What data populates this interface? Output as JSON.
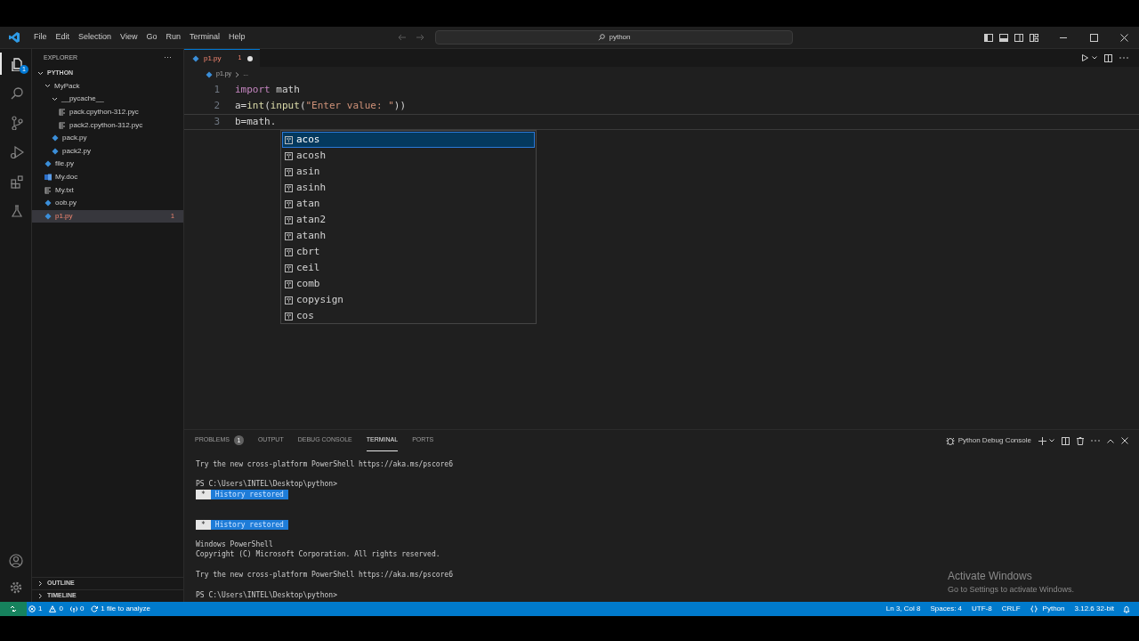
{
  "menu": [
    "File",
    "Edit",
    "Selection",
    "View",
    "Go",
    "Run",
    "Terminal",
    "Help"
  ],
  "search": {
    "value": "python"
  },
  "activity": [
    {
      "kind": "explorer",
      "selected": true,
      "badge": "1"
    },
    {
      "kind": "search",
      "selected": false
    },
    {
      "kind": "source-control",
      "selected": false
    },
    {
      "kind": "run",
      "selected": false
    },
    {
      "kind": "extensions",
      "selected": false
    },
    {
      "kind": "testing",
      "selected": false
    }
  ],
  "sidebar": {
    "title": "EXPLORER",
    "more": "···",
    "tree": [
      {
        "label": "PYTHON",
        "kind": "root",
        "expanded": true,
        "selected": false,
        "children": [
          {
            "label": "MyPack",
            "kind": "folder",
            "expanded": true,
            "selected": false,
            "children": [
              {
                "label": "__pycache__",
                "kind": "folder",
                "expanded": true,
                "selected": false,
                "children": [
                  {
                    "label": "pack.cpython-312.pyc",
                    "kind": "text",
                    "selected": false
                  },
                  {
                    "label": "pack2.cpython-312.pyc",
                    "kind": "text",
                    "selected": false
                  }
                ]
              },
              {
                "label": "pack.py",
                "kind": "python",
                "selected": false
              },
              {
                "label": "pack2.py",
                "kind": "python",
                "selected": false
              }
            ]
          },
          {
            "label": "file.py",
            "kind": "python",
            "selected": false
          },
          {
            "label": "My.doc",
            "kind": "word",
            "selected": false
          },
          {
            "label": "My.txt",
            "kind": "text",
            "selected": false
          },
          {
            "label": "oob.py",
            "kind": "python",
            "selected": false
          },
          {
            "label": "p1.py",
            "kind": "python",
            "selected": true,
            "error": true,
            "badge": "1"
          }
        ]
      }
    ],
    "sections": [
      {
        "label": "OUTLINE",
        "expanded": false
      },
      {
        "label": "TIMELINE",
        "expanded": false
      }
    ]
  },
  "tabs": [
    {
      "label": "p1.py",
      "selected": true,
      "badge": "1",
      "modified": true
    }
  ],
  "breadcrumbs": [
    "p1.py",
    "..."
  ],
  "code": [
    {
      "number": "1",
      "tokens": [
        {
          "kind": "keyword",
          "text": "import"
        },
        {
          "kind": "plain",
          "text": " math"
        }
      ]
    },
    {
      "number": "2",
      "tokens": [
        {
          "kind": "plain",
          "text": "a="
        },
        {
          "kind": "function",
          "text": "int"
        },
        {
          "kind": "plain",
          "text": "("
        },
        {
          "kind": "function",
          "text": "input"
        },
        {
          "kind": "plain",
          "text": "("
        },
        {
          "kind": "string",
          "text": "\"Enter value: \""
        },
        {
          "kind": "plain",
          "text": "))"
        }
      ]
    },
    {
      "number": "3",
      "active": true,
      "tokens": [
        {
          "kind": "plain",
          "text": "b=math."
        }
      ]
    }
  ],
  "suggestions": [
    {
      "label": "acos",
      "selected": true
    },
    {
      "label": "acosh",
      "selected": false
    },
    {
      "label": "asin",
      "selected": false
    },
    {
      "label": "asinh",
      "selected": false
    },
    {
      "label": "atan",
      "selected": false
    },
    {
      "label": "atan2",
      "selected": false
    },
    {
      "label": "atanh",
      "selected": false
    },
    {
      "label": "cbrt",
      "selected": false
    },
    {
      "label": "ceil",
      "selected": false
    },
    {
      "label": "comb",
      "selected": false
    },
    {
      "label": "copysign",
      "selected": false
    },
    {
      "label": "cos",
      "selected": false
    }
  ],
  "panel": {
    "tabs": [
      {
        "label": "PROBLEMS",
        "badge": "1",
        "selected": false
      },
      {
        "label": "OUTPUT",
        "selected": false
      },
      {
        "label": "DEBUG CONSOLE",
        "selected": false
      },
      {
        "label": "TERMINAL",
        "selected": true
      },
      {
        "label": "PORTS",
        "selected": false
      }
    ],
    "terminal_name": "Python Debug Console",
    "lines": [
      {
        "kind": "text",
        "text": "Try the new cross-platform PowerShell https://aka.ms/pscore6"
      },
      {
        "kind": "blank"
      },
      {
        "kind": "text",
        "text": "PS C:\\Users\\INTEL\\Desktop\\python>"
      },
      {
        "kind": "history",
        "marker": "*",
        "text": "History restored"
      },
      {
        "kind": "blank"
      },
      {
        "kind": "blank"
      },
      {
        "kind": "history",
        "marker": "*",
        "text": "History restored"
      },
      {
        "kind": "blank"
      },
      {
        "kind": "text",
        "text": "Windows PowerShell"
      },
      {
        "kind": "text",
        "text": "Copyright (C) Microsoft Corporation. All rights reserved."
      },
      {
        "kind": "blank"
      },
      {
        "kind": "text",
        "text": "Try the new cross-platform PowerShell https://aka.ms/pscore6"
      },
      {
        "kind": "blank"
      },
      {
        "kind": "text",
        "text": "PS C:\\Users\\INTEL\\Desktop\\python>"
      }
    ]
  },
  "activation": {
    "title": "Activate Windows",
    "subtitle": "Go to Settings to activate Windows."
  },
  "status_bar": {
    "left": [
      {
        "kind": "errors",
        "text": "1"
      },
      {
        "kind": "warnings",
        "text": "0"
      },
      {
        "kind": "ports",
        "text": "0"
      },
      {
        "kind": "analyze",
        "text": "1 file to analyze"
      }
    ],
    "right": [
      {
        "kind": "plain",
        "text": "Ln 3, Col 8"
      },
      {
        "kind": "plain",
        "text": "Spaces: 4"
      },
      {
        "kind": "plain",
        "text": "UTF-8"
      },
      {
        "kind": "plain",
        "text": "CRLF"
      },
      {
        "kind": "language",
        "text": "Python"
      },
      {
        "kind": "plain",
        "text": "3.12.6 32-bit"
      }
    ]
  }
}
